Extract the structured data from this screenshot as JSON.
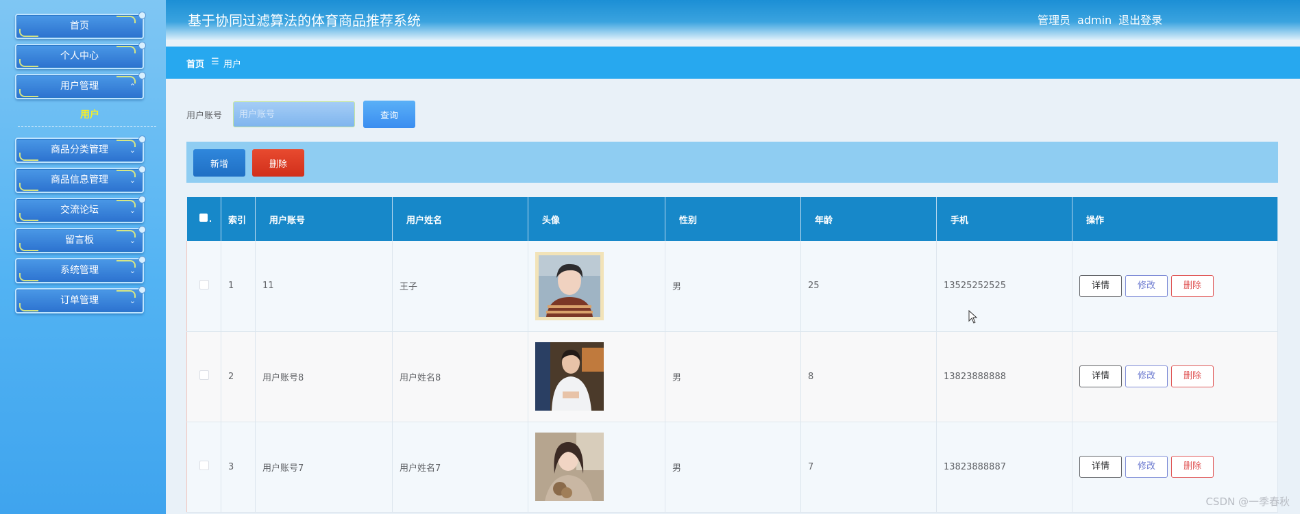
{
  "sidebar": {
    "menu": [
      {
        "label": "首页"
      },
      {
        "label": "个人中心"
      },
      {
        "label": "用户管理",
        "expanded": true
      },
      {
        "label": "商品分类管理"
      },
      {
        "label": "商品信息管理"
      },
      {
        "label": "交流论坛"
      },
      {
        "label": "留言板"
      },
      {
        "label": "系统管理"
      },
      {
        "label": "订单管理"
      }
    ],
    "submenu_active": "用户"
  },
  "header": {
    "title": "基于协同过滤算法的体育商品推荐系统",
    "role": "管理员",
    "username": "admin",
    "logout": "退出登录"
  },
  "breadcrumb": {
    "home": "首页",
    "separator": "☰",
    "current": "用户"
  },
  "search": {
    "label": "用户账号",
    "placeholder": "用户账号",
    "button": "查询"
  },
  "actions": {
    "add": "新增",
    "delete": "删除"
  },
  "table": {
    "headers": [
      "索引",
      "用户账号",
      "用户姓名",
      "头像",
      "性别",
      "年龄",
      "手机",
      "操作"
    ],
    "rows": [
      {
        "index": "1",
        "account": "11",
        "name": "王子",
        "avatar": "avatar-portrait-1",
        "gender": "男",
        "age": "25",
        "phone": "13525252525"
      },
      {
        "index": "2",
        "account": "用户账号8",
        "name": "用户姓名8",
        "avatar": "avatar-portrait-2",
        "gender": "男",
        "age": "8",
        "phone": "13823888888"
      },
      {
        "index": "3",
        "account": "用户账号7",
        "name": "用户姓名7",
        "avatar": "avatar-portrait-3",
        "gender": "男",
        "age": "7",
        "phone": "13823888887"
      }
    ],
    "row_actions": {
      "detail": "详情",
      "edit": "修改",
      "delete": "删除"
    }
  },
  "watermark": "CSDN @一季春秋",
  "colors": {
    "sidebar": "#52b3f3",
    "header": "#1c8fd5",
    "breadcrumb_bar": "#27a8ef",
    "table_header": "#1788c9",
    "delete": "#d12f1b",
    "submenu_active": "#f2ee2c"
  }
}
